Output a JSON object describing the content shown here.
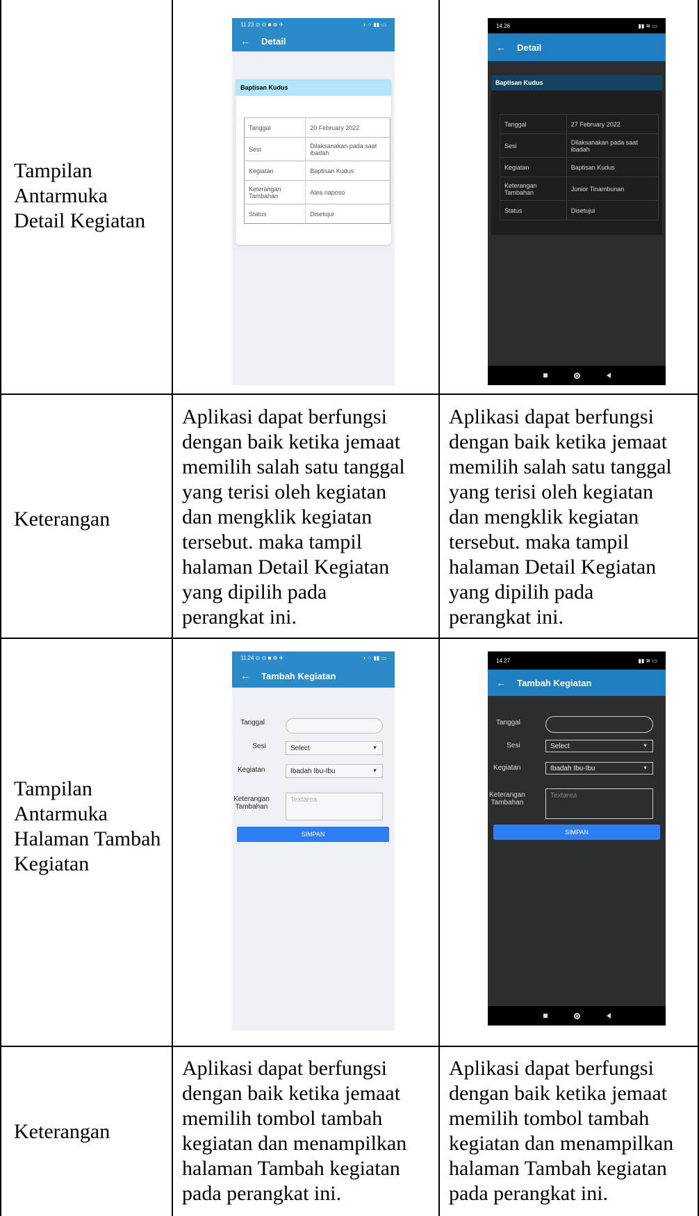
{
  "rows": {
    "detail_label": "Tampilan Antarmuka Detail Kegiatan",
    "keterangan_label": "Keterangan",
    "detail_desc": "Aplikasi dapat berfungsi\ndengan baik ketika jemaat\nmemilih salah satu tanggal\nyang terisi oleh kegiatan\ndan mengklik kegiatan\ntersebut. maka tampil\nhalaman Detail Kegiatan\nyang dipilih pada\nperangkat ini.",
    "tambah_label": "Tampilan Antarmuka Halaman Tambah Kegiatan",
    "keterangan2_label": "Keterangan",
    "tambah_desc": "Aplikasi dapat berfungsi\ndengan baik ketika jemaat\nmemilih tombol tambah\nkegiatan dan menampilkan\nhalaman Tambah kegiatan\npada perangkat ini."
  },
  "detail_light": {
    "status_time": "11.23",
    "status_icons_left": "⊙ ⊙ ■ ⊛ ✈",
    "status_icons_right": "◑ ⁘ ▮▮ ▭",
    "title": "Detail",
    "back": "←",
    "card_title": "Baptisan Kudus",
    "rows": [
      {
        "k": "Tanggal",
        "v": "20 February 2022"
      },
      {
        "k": "Sesi",
        "v": "Dilaksanakan pada saat ibadah"
      },
      {
        "k": "Kegiatan",
        "v": "Baptisan Kudus"
      },
      {
        "k": "Keterangan Tambahan",
        "v": "Alea naposo"
      },
      {
        "k": "Status",
        "v": "Disetujui"
      }
    ]
  },
  "detail_dark": {
    "status_time": "14.26",
    "status_icons_right": "▮▮ ≋ ▭",
    "title": "Detail",
    "back": "←",
    "card_title": "Baptisan Kudus",
    "rows": [
      {
        "k": "Tanggal",
        "v": "27 February 2022"
      },
      {
        "k": "Sesi",
        "v": "Dilaksanakan pada saat ibadah"
      },
      {
        "k": "Kegiatan",
        "v": "Baptisan Kudus"
      },
      {
        "k": "Keterangan Tambahan",
        "v": "Junior Tinambunan"
      },
      {
        "k": "Status",
        "v": "Disetujui"
      }
    ]
  },
  "form_light": {
    "status_time": "11.24",
    "status_icons_left": "⊙ ⊙ ■ ⊛ ✈",
    "status_icons_right": "◑ ⁘ ▮▮ ▭",
    "title": "Tambah Kegiatan",
    "back": "←",
    "tanggal_label": "Tanggal",
    "sesi_label": "Sesi",
    "sesi_value": "Select",
    "kegiatan_label": "Kegiatan",
    "kegiatan_value": "Ibadah Ibu-Ibu",
    "keterangan_label": "Keterangan Tambahan",
    "textarea_placeholder": "Textarea",
    "button": "SIMPAN"
  },
  "form_dark": {
    "status_time": "14.27",
    "status_icons_right": "▮▮ ≋ ▭",
    "title": "Tambah Kegiatan",
    "back": "←",
    "tanggal_label": "Tanggal",
    "sesi_label": "Sesi",
    "sesi_value": "Select",
    "kegiatan_label": "Kegiatan",
    "kegiatan_value": "Ibadah Ibu-Ibu",
    "keterangan_label": "Keterangan Tambahan",
    "textarea_placeholder": "Textarea",
    "button": "SIMPAN"
  }
}
